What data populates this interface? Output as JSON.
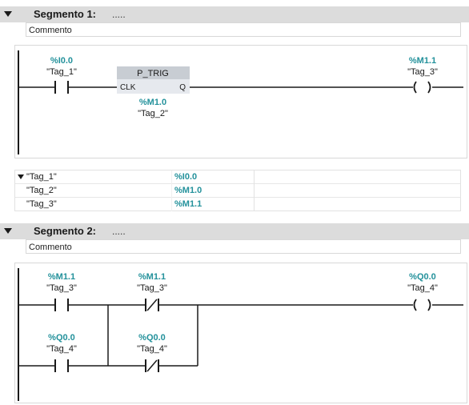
{
  "segment1": {
    "title": "Segmento 1:",
    "dots": ".....",
    "comment": "Commento",
    "no_contact": {
      "addr": "%I0.0",
      "tag": "\"Tag_1\""
    },
    "ptrig": {
      "name": "P_TRIG",
      "pin_in": "CLK",
      "pin_out": "Q",
      "addr": "%M1.0",
      "tag": "\"Tag_2\""
    },
    "coil": {
      "addr": "%M1.1",
      "tag": "\"Tag_3\"",
      "symbol": "( )"
    }
  },
  "tag_table": [
    {
      "name": "\"Tag_1\"",
      "addr": "%I0.0"
    },
    {
      "name": "\"Tag_2\"",
      "addr": "%M1.0"
    },
    {
      "name": "\"Tag_3\"",
      "addr": "%M1.1"
    }
  ],
  "segment2": {
    "title": "Segmento 2:",
    "dots": ".....",
    "comment": "Commento",
    "contact_a": {
      "addr": "%M1.1",
      "tag": "\"Tag_3\""
    },
    "contact_b": {
      "addr": "%M1.1",
      "tag": "\"Tag_3\""
    },
    "contact_c": {
      "addr": "%Q0.0",
      "tag": "\"Tag_4\""
    },
    "contact_d": {
      "addr": "%Q0.0",
      "tag": "\"Tag_4\""
    },
    "coil": {
      "addr": "%Q0.0",
      "tag": "\"Tag_4\"",
      "symbol": "( )"
    }
  },
  "colors": {
    "address": "#23919b",
    "header_bg": "#dcdcdc",
    "line": "#1a1a1a",
    "box_header": "#c8cdd3",
    "box_body": "#e6e9ee"
  }
}
